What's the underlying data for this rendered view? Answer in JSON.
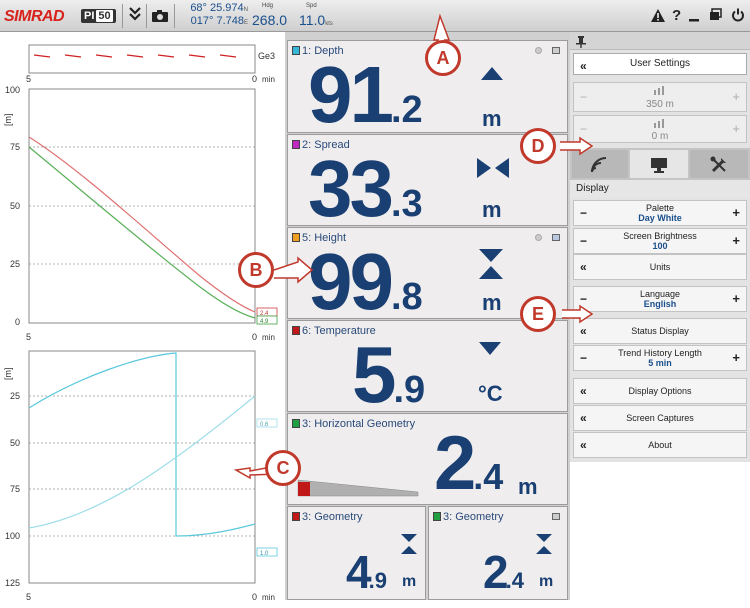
{
  "topbar": {
    "brand": "SIMRAD",
    "model": "PI",
    "model_suffix": "50",
    "lat": "68° 25.974",
    "lat_hemi": "N",
    "lon": "017° 7.748",
    "lon_hemi": "E",
    "hdg_label": "Hdg",
    "hdg_value": "268.0",
    "spd_label": "Spd",
    "spd_value": "11.0",
    "spd_unit": "kts"
  },
  "charts": {
    "top_strip": {
      "right_label": "Ge3",
      "x_left": "5",
      "x_right": "0",
      "x_unit": "min"
    },
    "upper": {
      "y_unit": "[m]",
      "y_ticks": [
        "100",
        "75",
        "50",
        "25",
        "0"
      ],
      "x_left": "5",
      "x_right": "0",
      "x_unit": "min",
      "end_labels": [
        "2.4",
        "4.9"
      ]
    },
    "lower": {
      "y_unit": "[m]",
      "y_ticks": [
        "25",
        "50",
        "75",
        "100",
        "125"
      ],
      "x_left": "5",
      "x_right": "0",
      "x_unit": "min",
      "end_labels": [
        "0.6",
        "1.0"
      ]
    }
  },
  "tiles": {
    "depth": {
      "label": "1: Depth",
      "int": "91",
      "dec": ".2",
      "unit": "m",
      "color": "#35b8d8"
    },
    "spread": {
      "label": "2: Spread",
      "int": "33",
      "dec": ".3",
      "unit": "m",
      "color": "#c02ac0"
    },
    "height": {
      "label": "5: Height",
      "int": "99",
      "dec": ".8",
      "unit": "m",
      "color": "#f0a020"
    },
    "temperature": {
      "label": "6: Temperature",
      "int": "5",
      "dec": ".9",
      "unit": "°C",
      "color": "#c01818"
    },
    "hgeom": {
      "label": "3: Horizontal Geometry",
      "int": "2",
      "dec": ".4",
      "unit": "m",
      "color": "#20a040"
    },
    "geom_left": {
      "label": "3: Geometry",
      "int": "4",
      "dec": ".9",
      "unit": "m",
      "color": "#c01818"
    },
    "geom_right": {
      "label": "3: Geometry",
      "int": "2",
      "dec": ".4",
      "unit": "m",
      "color": "#20a040"
    }
  },
  "settings": {
    "header": "User Settings",
    "range1": "350 m",
    "range2": "0 m",
    "section": "Display",
    "palette_label": "Palette",
    "palette_value": "Day White",
    "brightness_label": "Screen Brightness",
    "brightness_value": "100",
    "units": "Units",
    "language_label": "Language",
    "language_value": "English",
    "status_display": "Status Display",
    "trend_label": "Trend History Length",
    "trend_value": "5 min",
    "display_options": "Display Options",
    "screen_captures": "Screen Captures",
    "about": "About",
    "minus": "−",
    "plus": "+",
    "back": "«"
  },
  "callouts": [
    "A",
    "B",
    "C",
    "D",
    "E"
  ]
}
